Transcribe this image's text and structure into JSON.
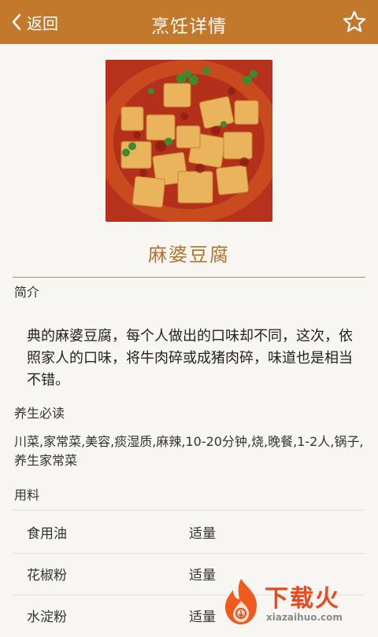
{
  "header": {
    "back_label": "返回",
    "title": "烹饪详情"
  },
  "recipe": {
    "name": "麻婆豆腐",
    "intro_heading": "简介",
    "intro_text": "典的麻婆豆腐，每个人做出的口味却不同，这次，依照家人的口味，将牛肉碎或成猪肉碎，味道也是相当不错。",
    "health_heading": "养生必读",
    "tags_text": "川菜,家常菜,美容,痰湿质,麻辣,10-20分钟,烧,晚餐,1-2人,锅子,养生家常菜",
    "ingredients_heading": "用料",
    "ingredients": [
      {
        "name": "食用油",
        "qty": "适量"
      },
      {
        "name": "花椒粉",
        "qty": "适量"
      },
      {
        "name": "水淀粉",
        "qty": "适量"
      }
    ]
  },
  "watermark": {
    "text": "下载火",
    "url": "xiazaihuo.com"
  },
  "colors": {
    "header_bg": "#c3792c",
    "accent_title": "#b0742c",
    "watermark": "#e84a1c"
  }
}
